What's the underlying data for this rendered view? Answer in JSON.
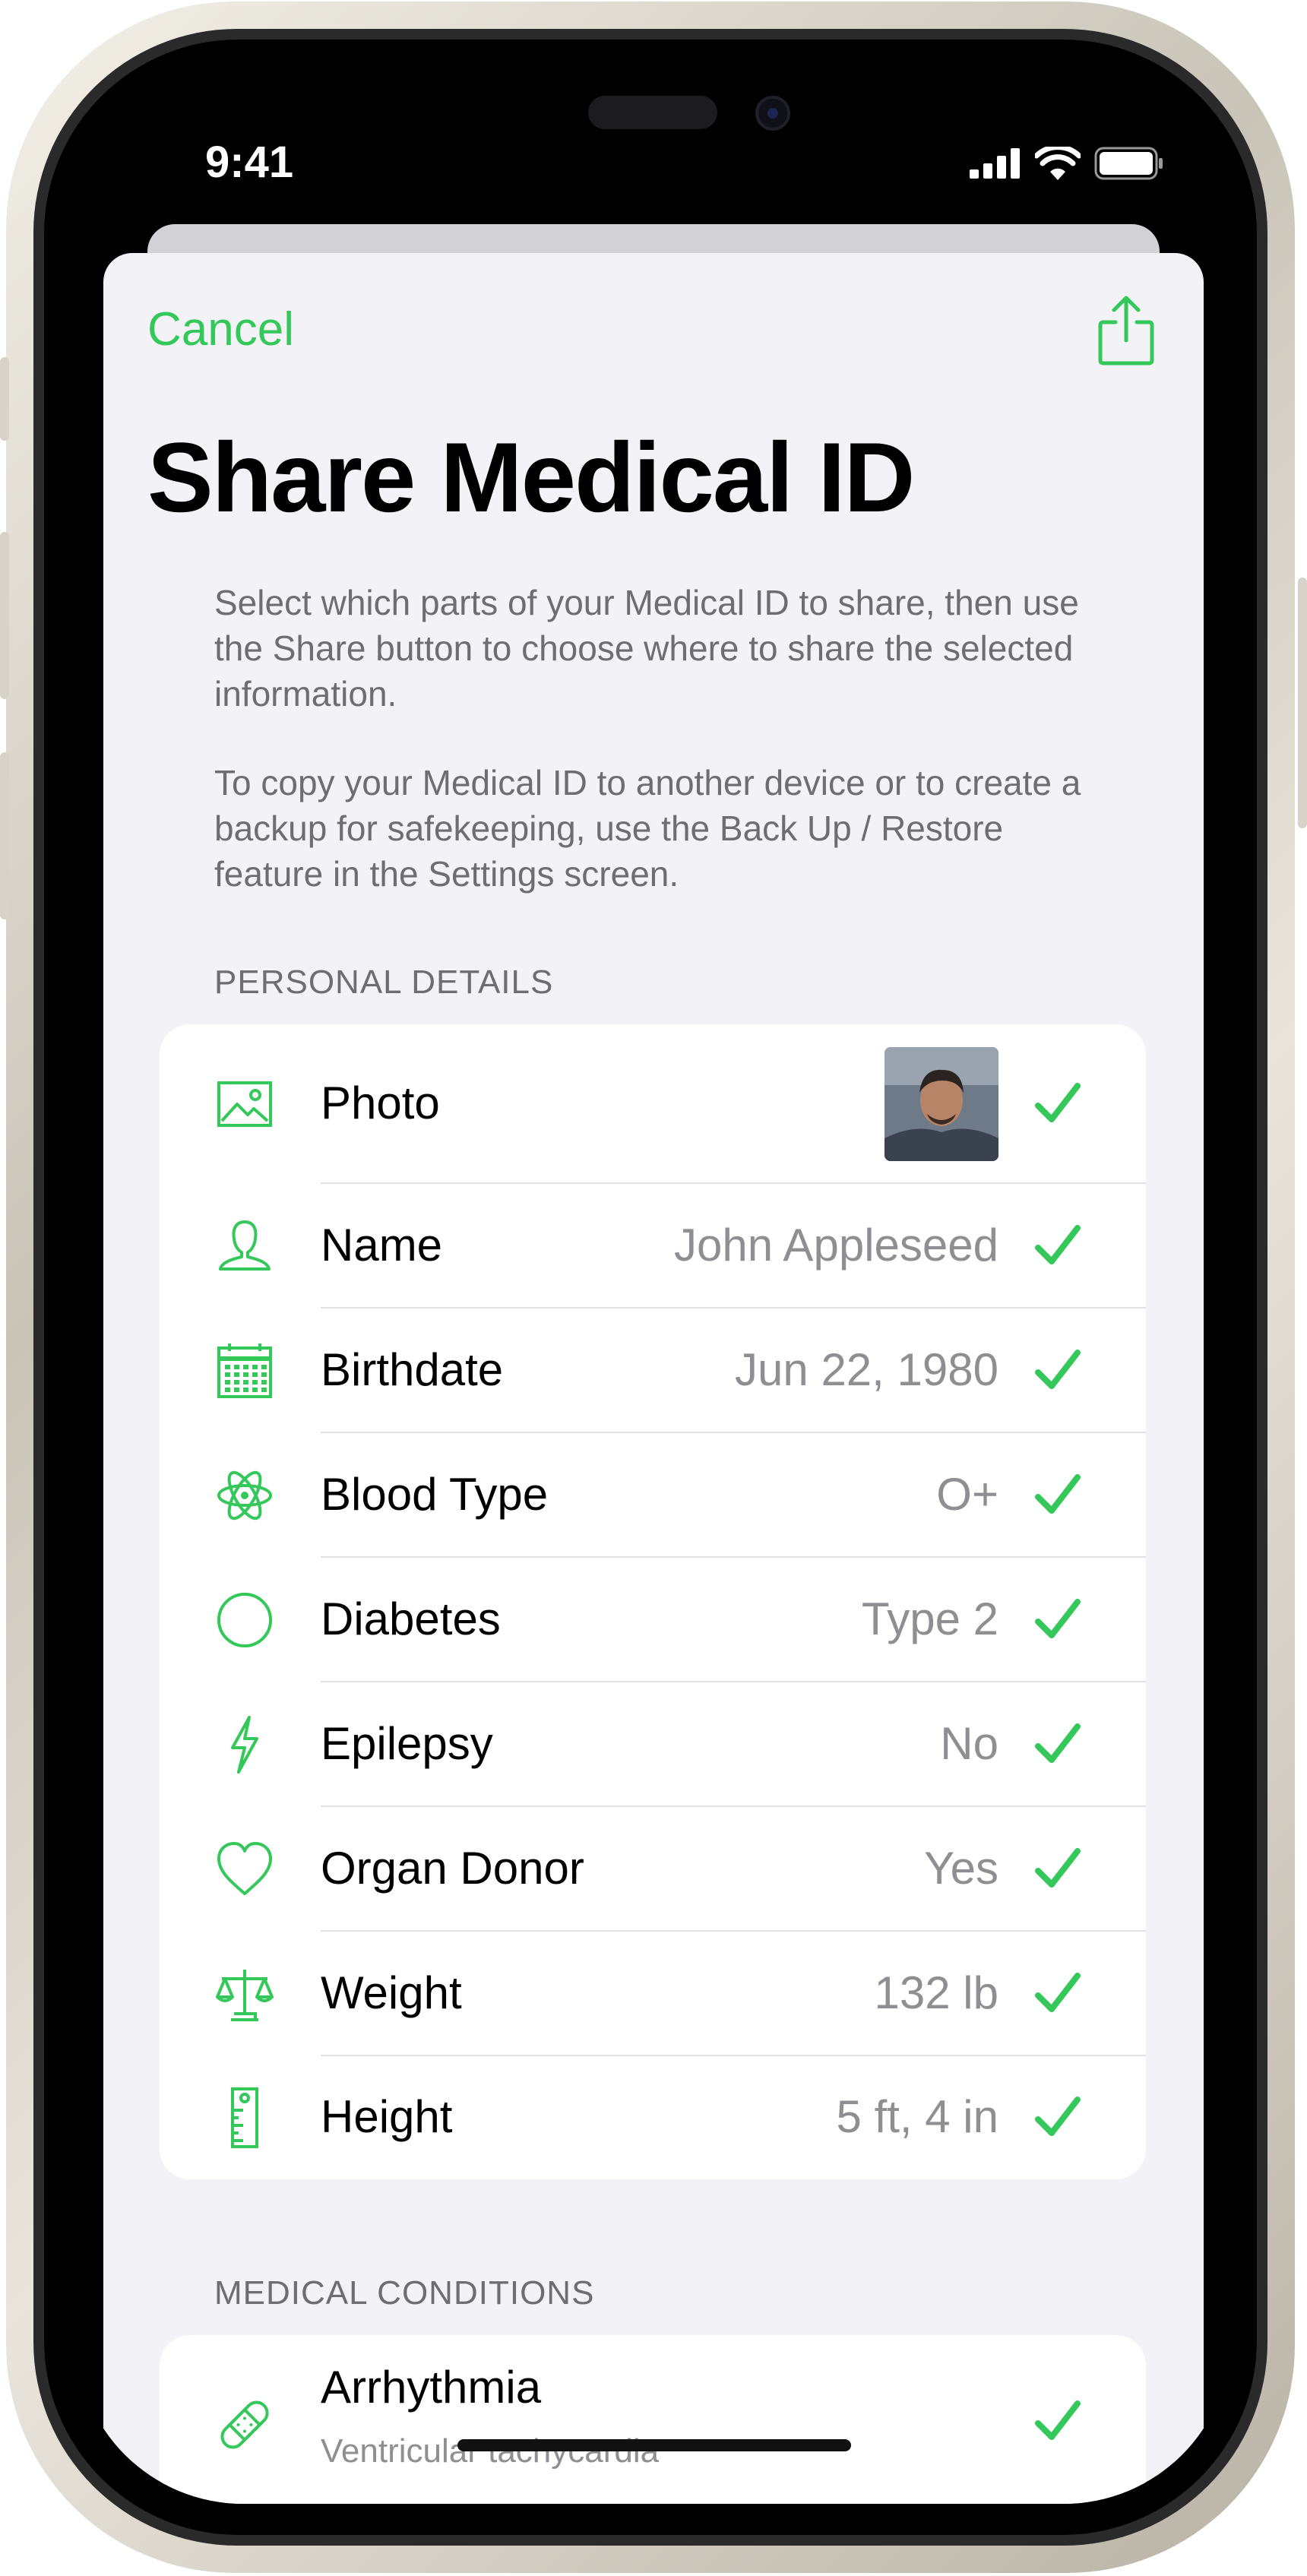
{
  "status_bar": {
    "time": "9:41"
  },
  "nav": {
    "cancel_label": "Cancel",
    "share_icon": "share-icon"
  },
  "title": "Share Medical ID",
  "description": {
    "paragraph1": "Select which parts of your Medical ID to share, then use the Share button to choose where to share the selected information.",
    "paragraph2": "To copy your Medical ID to another device or to create a backup for safekeeping, use the Back Up / Restore feature in the Settings screen."
  },
  "personal_details": {
    "header": "PERSONAL DETAILS",
    "rows": [
      {
        "icon": "photo-icon",
        "label": "Photo",
        "value": "",
        "checked": true
      },
      {
        "icon": "person-icon",
        "label": "Name",
        "value": "John Appleseed",
        "checked": true
      },
      {
        "icon": "calendar-icon",
        "label": "Birthdate",
        "value": "Jun 22, 1980",
        "checked": true
      },
      {
        "icon": "atom-icon",
        "label": "Blood Type",
        "value": "O+",
        "checked": true
      },
      {
        "icon": "circle-icon",
        "label": "Diabetes",
        "value": "Type 2",
        "checked": true
      },
      {
        "icon": "bolt-icon",
        "label": "Epilepsy",
        "value": "No",
        "checked": true
      },
      {
        "icon": "heart-icon",
        "label": "Organ Donor",
        "value": "Yes",
        "checked": true
      },
      {
        "icon": "scale-icon",
        "label": "Weight",
        "value": "132 lb",
        "checked": true
      },
      {
        "icon": "ruler-icon",
        "label": "Height",
        "value": "5 ft, 4 in",
        "checked": true
      }
    ]
  },
  "medical_conditions": {
    "header": "MEDICAL CONDITIONS",
    "rows": [
      {
        "icon": "bandage-icon",
        "label": "Arrhythmia",
        "detail": "Ventricular tachycardia",
        "checked": true
      }
    ]
  },
  "colors": {
    "accent": "#34c759",
    "background": "#f2f2f7",
    "secondary_text": "#8e8e93"
  }
}
